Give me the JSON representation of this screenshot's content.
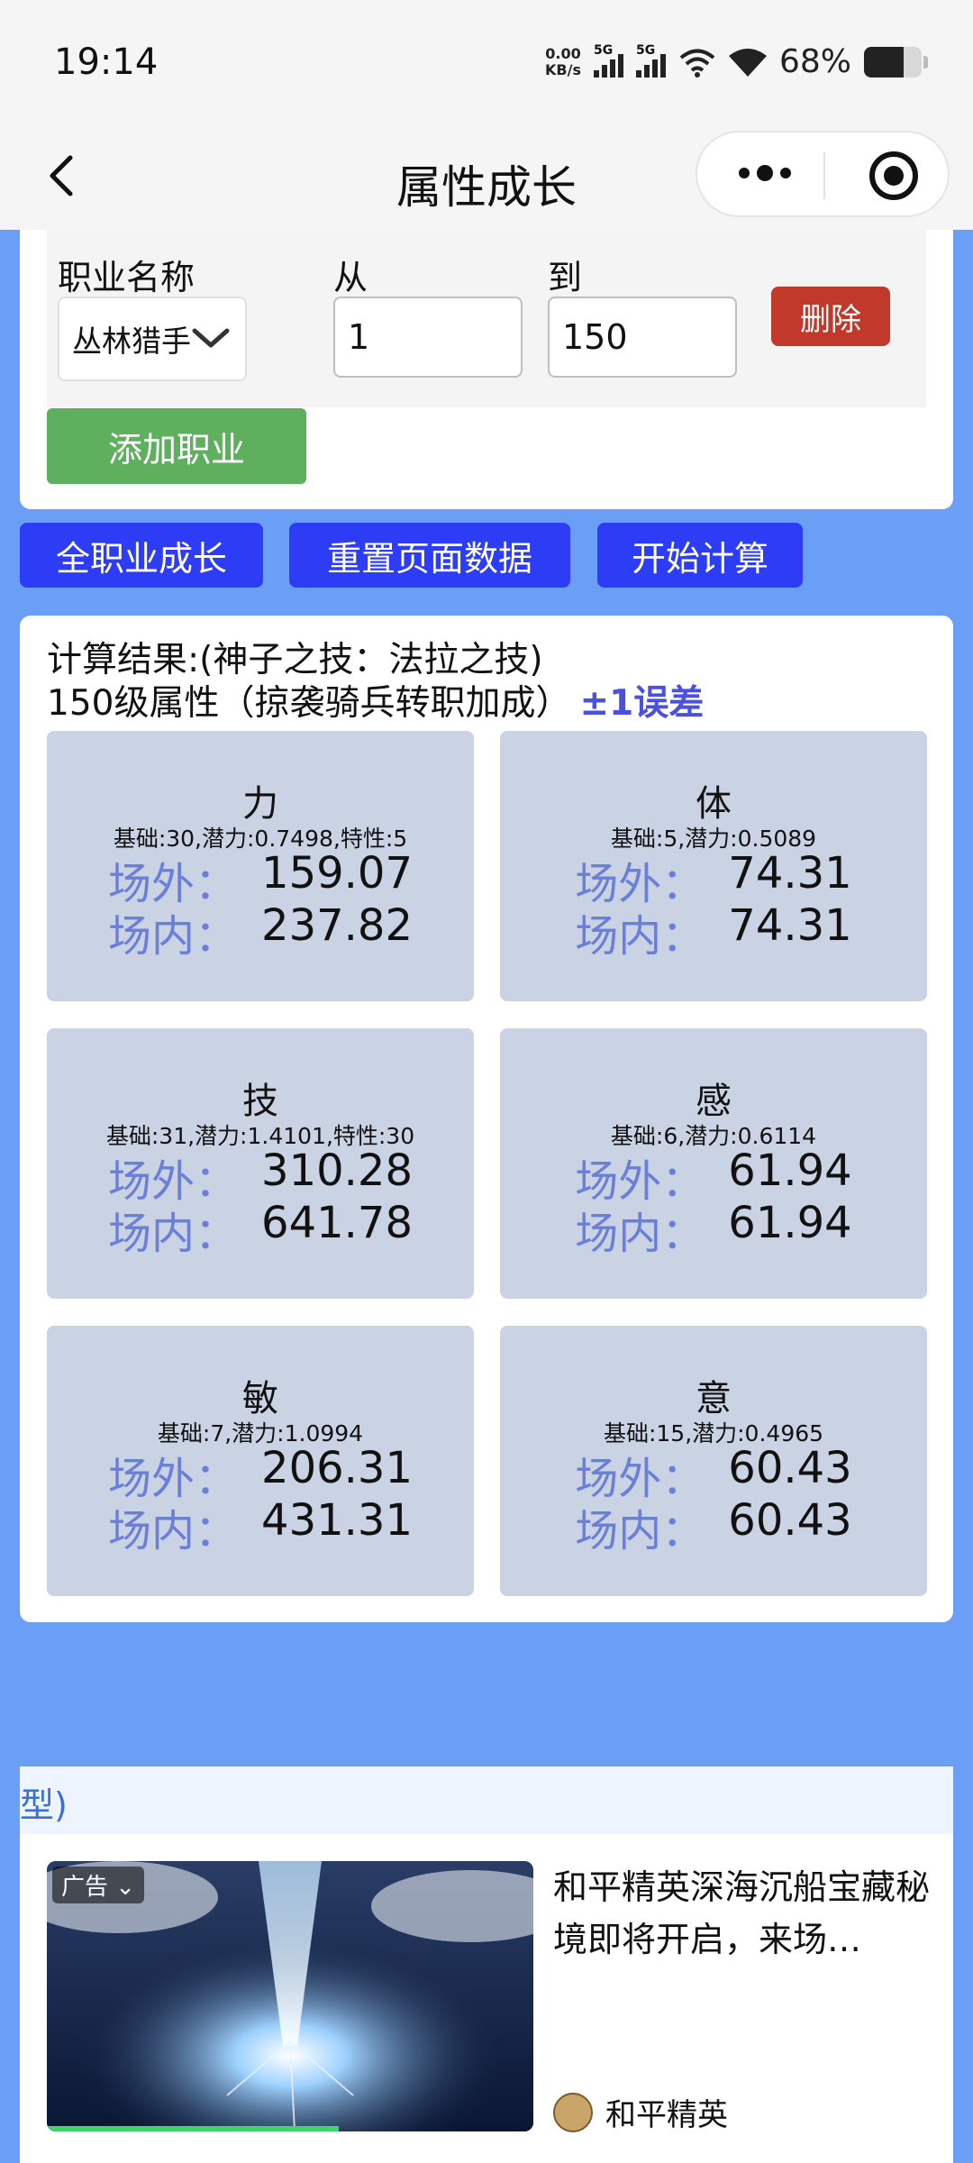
{
  "status_bar": {
    "time": "19:14",
    "net_speed_value": "0.00",
    "net_speed_unit": "KB/s",
    "sim1": "5G",
    "sim2": "5G",
    "battery_text": "68%",
    "battery_level": 0.68
  },
  "nav": {
    "title": "属性成长"
  },
  "job": {
    "name_label": "职业名称",
    "from_label": "从",
    "to_label": "到",
    "selected_job": "丛林猎手",
    "from_value": "1",
    "to_value": "150",
    "delete_label": "删除",
    "add_label": "添加职业"
  },
  "actions": {
    "all_growth": "全职业成长",
    "reset": "重置页面数据",
    "calculate": "开始计算"
  },
  "result": {
    "title": "计算结果:(神子之技：法拉之技)",
    "subtitle": "150级属性（掠袭骑兵转职加成）",
    "error_note": "±1误差",
    "outside_label": "场外：",
    "inside_label": "场内：",
    "stats": [
      {
        "name": "力",
        "info": "基础:30,潜力:0.7498,特性:5",
        "outside": "159.07",
        "inside": "237.82"
      },
      {
        "name": "体",
        "info": "基础:5,潜力:0.5089",
        "outside": "74.31",
        "inside": "74.31"
      },
      {
        "name": "技",
        "info": "基础:31,潜力:1.4101,特性:30",
        "outside": "310.28",
        "inside": "641.78"
      },
      {
        "name": "感",
        "info": "基础:6,潜力:0.6114",
        "outside": "61.94",
        "inside": "61.94"
      },
      {
        "name": "敏",
        "info": "基础:7,潜力:1.0994",
        "outside": "206.31",
        "inside": "431.31"
      },
      {
        "name": "意",
        "info": "基础:15,潜力:0.4965",
        "outside": "60.43",
        "inside": "60.43"
      }
    ]
  },
  "ad": {
    "strip_text": "型)",
    "tag": "广告",
    "text": "和平精英深海沉船宝藏秘境即将开启，来场…",
    "source": "和平精英",
    "video_progress": 0.6
  }
}
